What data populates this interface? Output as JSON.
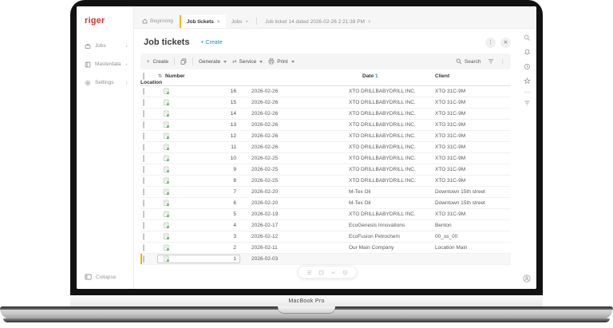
{
  "device": {
    "label": "MacBook Pro"
  },
  "colors": {
    "accent_blue": "#1e88e5",
    "highlight_yellow": "#f0b400",
    "logo_red": "#d7312c"
  },
  "icons": {
    "plus": "+",
    "close": "×",
    "kebab": "⋮",
    "chevron_right": "›",
    "swap_arrows": "⇄",
    "sort": "⇅"
  },
  "sidebar": {
    "logo": "riger",
    "items": [
      {
        "label": "Jobs"
      },
      {
        "label": "Masterdata"
      },
      {
        "label": "Settings"
      }
    ],
    "collapse_label": "Collapse"
  },
  "tabbar": {
    "home_label": "Beginning",
    "tabs": [
      {
        "label": "Job tickets",
        "active": true
      },
      {
        "label": "Jobs",
        "active": false
      },
      {
        "label": "Job ticket 14 dated 2026-02-26 2:21:38 PM",
        "active": false
      }
    ]
  },
  "header": {
    "title": "Job tickets",
    "create_label": "+ Create"
  },
  "toolbar": {
    "create_label": "Create",
    "generate_label": "Generate",
    "service_label": "Service",
    "print_label": "Print",
    "search_label": "Search"
  },
  "table": {
    "columns": {
      "number": "Number",
      "date": "Date",
      "client": "Client",
      "location": "Location"
    },
    "sort_indicator": "1",
    "rows": [
      {
        "number": "16",
        "date": "2026-02-26",
        "client": "XTO DRILLBABYDRILL INC.",
        "location": "XTO 31C-9M"
      },
      {
        "number": "15",
        "date": "2026-02-26",
        "client": "XTO DRILLBABYDRILL INC.",
        "location": "XTO 31C-9M"
      },
      {
        "number": "14",
        "date": "2026-02-26",
        "client": "XTO DRILLBABYDRILL INC.",
        "location": "XTO 31C-9M"
      },
      {
        "number": "13",
        "date": "2026-02-26",
        "client": "XTO DRILLBABYDRILL INC.",
        "location": "XTO 31C-9M"
      },
      {
        "number": "12",
        "date": "2026-02-26",
        "client": "XTO DRILLBABYDRILL INC.",
        "location": "XTO 31C-9M"
      },
      {
        "number": "11",
        "date": "2026-02-26",
        "client": "XTO DRILLBABYDRILL INC.",
        "location": "XTO 31C-9M"
      },
      {
        "number": "10",
        "date": "2026-02-25",
        "client": "XTO DRILLBABYDRILL INC.",
        "location": "XTO 31C-9M"
      },
      {
        "number": "9",
        "date": "2026-02-25",
        "client": "XTO DRILLBABYDRILL INC.",
        "location": "XTO 31C-9M"
      },
      {
        "number": "8",
        "date": "2026-02-25",
        "client": "XTO DRILLBABYDRILL INC.",
        "location": "XTO 31C-9M"
      },
      {
        "number": "7",
        "date": "2026-02-20",
        "client": "M-Tex Oil",
        "location": "Downtown 15th street"
      },
      {
        "number": "6",
        "date": "2026-02-20",
        "client": "M-Tex Oil",
        "location": "Downtown 15th street"
      },
      {
        "number": "5",
        "date": "2026-02-19",
        "client": "XTO DRILLBABYDRILL INC.",
        "location": "XTO 31C-9M"
      },
      {
        "number": "4",
        "date": "2026-02-17",
        "client": "EcoGenesis Innovations",
        "location": "Benton"
      },
      {
        "number": "3",
        "date": "2026-02-12",
        "client": "EcoFusion Petrochem",
        "location": "00_ss_00"
      },
      {
        "number": "2",
        "date": "2026-02-11",
        "client": "Our Main Company",
        "location": "Location Main"
      },
      {
        "number": "1",
        "date": "2026-02-03",
        "client": "",
        "location": "",
        "selected": true
      }
    ]
  }
}
